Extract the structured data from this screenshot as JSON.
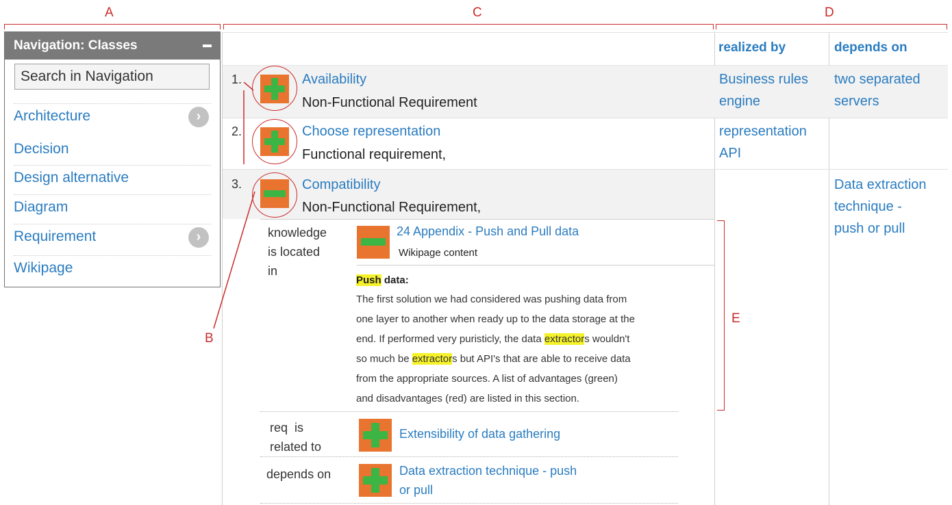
{
  "annotations": {
    "A": "A",
    "B": "B",
    "C": "C",
    "D": "D",
    "E": "E"
  },
  "navigation": {
    "title": "Navigation: Classes",
    "search_placeholder": "Search in Navigation",
    "items": [
      {
        "label": "Architecture",
        "has_arrow": true
      },
      {
        "label": "Decision",
        "has_arrow": false
      },
      {
        "label": "Design alternative",
        "has_arrow": false
      },
      {
        "label": "Diagram",
        "has_arrow": false
      },
      {
        "label": "Requirement",
        "has_arrow": true
      },
      {
        "label": "Wikipage",
        "has_arrow": false
      }
    ],
    "arrow_glyph": "›"
  },
  "table": {
    "headers": {
      "realized_by": "realized by",
      "depends_on": "depends on"
    },
    "rows": [
      {
        "num": "1.",
        "title": "Availability",
        "type": "Non-Functional Requirement",
        "icon": "plus-icon",
        "realized_by": [
          "Business rules",
          "engine"
        ],
        "depends_on": [
          "two separated",
          "servers"
        ]
      },
      {
        "num": "2.",
        "title": "Choose representation",
        "type": "Functional requirement,",
        "icon": "plus-icon",
        "realized_by": [
          "representation",
          "API"
        ],
        "depends_on": []
      },
      {
        "num": "3.",
        "title": "Compatibility",
        "type": "Non-Functional Requirement,",
        "icon": "minus-icon",
        "realized_by": [],
        "depends_on": [
          "Data extraction",
          "technique -",
          "push or pull"
        ]
      }
    ],
    "details": {
      "knowledge_label": [
        "knowledge",
        "is located",
        "in"
      ],
      "wiki_title": "24 Appendix - Push and Pull data",
      "wiki_type": "Wikipage content",
      "push_word": "Push",
      "push_heading_rest": " data:",
      "lines": [
        {
          "pre": "The first solution we had considered was pushing data from",
          "hl": "",
          "post": ""
        },
        {
          "pre": "one layer to another when ready up to the data storage at the",
          "hl": "",
          "post": ""
        },
        {
          "pre": "end. If performed very puristicly, the data ",
          "hl": "extractor",
          "post": "s wouldn't"
        },
        {
          "pre": "so much be ",
          "hl": "extractor",
          "post": "s but API's that are able to receive data"
        },
        {
          "pre": "from the appropriate sources. A list of advantages (green)",
          "hl": "",
          "post": ""
        },
        {
          "pre": "and disadvantages (red) are listed in this section.",
          "hl": "",
          "post": ""
        }
      ],
      "req_label": [
        "req  is",
        "related to"
      ],
      "req_link": "Extensibility of data gathering",
      "dep_label": "depends on",
      "dep_link": [
        "Data extraction technique - push",
        "or pull"
      ]
    }
  },
  "colors": {
    "accent": "#2a7cc0",
    "annotation": "#cc2a2a",
    "icon_orange": "#e8742f",
    "icon_green": "#3db544",
    "highlight": "#f6f22a",
    "nav_header": "#7a7a7a"
  }
}
